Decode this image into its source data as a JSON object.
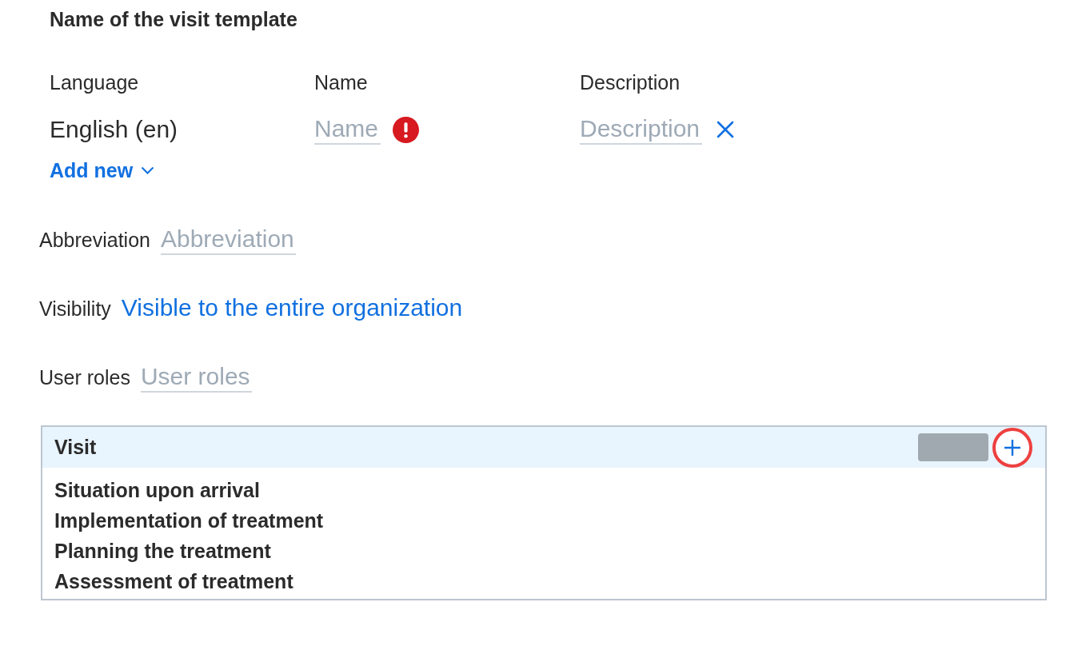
{
  "title": "Name of the visit template",
  "translations": {
    "columns": [
      "Language",
      "Name",
      "Description"
    ],
    "rows": [
      {
        "language": "English (en)",
        "name": {
          "placeholder": "Name",
          "error": true
        },
        "description": {
          "placeholder": "Description"
        },
        "removable": true
      }
    ],
    "add_new": "Add new"
  },
  "fields": [
    {
      "kind": "input",
      "label": "Abbreviation",
      "placeholder": "Abbreviation"
    },
    {
      "kind": "link",
      "label": "Visibility",
      "value": "Visible to the entire organization"
    },
    {
      "kind": "input",
      "label": "User roles",
      "placeholder": "User roles"
    }
  ],
  "visit_panel": {
    "title": "Visit",
    "add_button": {
      "highlighted": true
    },
    "items": [
      "Situation upon arrival",
      "Implementation of treatment",
      "Planning the treatment",
      "Assessment of treatment"
    ]
  }
}
